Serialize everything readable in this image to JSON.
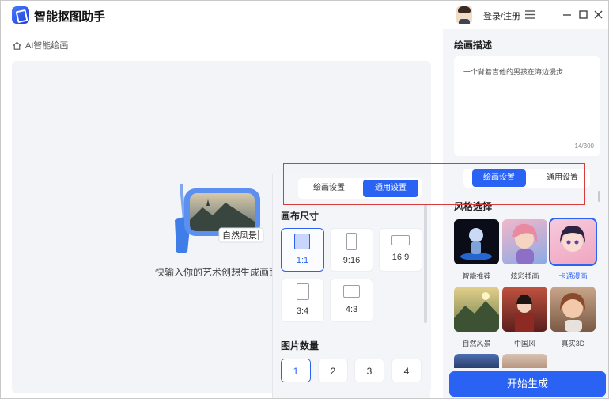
{
  "titlebar": {
    "app_title": "智能抠图助手",
    "login_label": "登录/注册"
  },
  "breadcrumb": {
    "label": "AI智能绘画"
  },
  "canvas": {
    "badge_label": "自然风景",
    "empty_hint": "快输入你的艺术创想生成画面"
  },
  "popover": {
    "tabs": [
      {
        "label": "绘画设置",
        "active": false
      },
      {
        "label": "通用设置",
        "active": true
      }
    ],
    "size_title": "画布尺寸",
    "sizes": [
      {
        "label": "1:1",
        "selected": true
      },
      {
        "label": "9:16",
        "selected": false
      },
      {
        "label": "16:9",
        "selected": false
      },
      {
        "label": "3:4",
        "selected": false
      },
      {
        "label": "4:3",
        "selected": false
      }
    ],
    "count_title": "图片数量",
    "counts": [
      {
        "label": "1",
        "selected": true
      },
      {
        "label": "2",
        "selected": false
      },
      {
        "label": "3",
        "selected": false
      },
      {
        "label": "4",
        "selected": false
      }
    ]
  },
  "right_panel": {
    "desc_title": "绘画描述",
    "desc_text": "一个背着吉他的男孩在海边漫步",
    "desc_count": "14/300",
    "tabs": [
      {
        "label": "绘画设置",
        "active": true
      },
      {
        "label": "通用设置",
        "active": false
      }
    ],
    "style_title": "风格选择",
    "styles": [
      {
        "label": "智能推荐",
        "selected": false
      },
      {
        "label": "炫彩插画",
        "selected": false
      },
      {
        "label": "卡通漫画",
        "selected": true
      },
      {
        "label": "自然风景",
        "selected": false
      },
      {
        "label": "中国风",
        "selected": false
      },
      {
        "label": "真实3D",
        "selected": false
      }
    ],
    "generate_label": "开始生成"
  },
  "colors": {
    "accent": "#2a63f3",
    "highlight": "#d93a3a",
    "panel_bg": "#f4f5f8"
  }
}
